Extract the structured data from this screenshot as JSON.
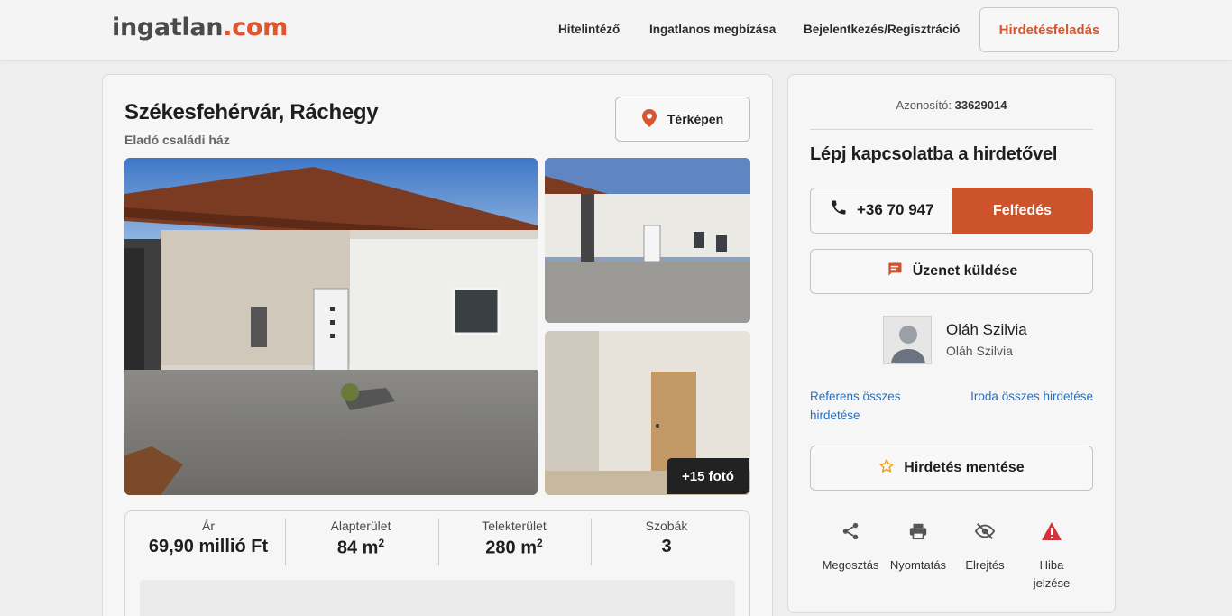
{
  "header": {
    "logo_main": "ingatlan",
    "logo_tld": ".com",
    "nav": [
      "Hitelintéző",
      "Ingatlanos megbízása",
      "Bejelentkezés/Regisztráció"
    ],
    "post_label": "Hirdetésfeladás"
  },
  "listing": {
    "title": "Székesfehérvár, Ráchegy",
    "subtitle": "Eladó családi ház",
    "map_label": "Térképen",
    "more_photos": "+15 fotó"
  },
  "stats": [
    {
      "label": "Ár",
      "value": "69,90 millió Ft",
      "unit_sup": ""
    },
    {
      "label": "Alapterület",
      "value": "84 m",
      "unit_sup": "2"
    },
    {
      "label": "Telekterület",
      "value": "280 m",
      "unit_sup": "2"
    },
    {
      "label": "Szobák",
      "value": "3",
      "unit_sup": ""
    }
  ],
  "side": {
    "id_label": "Azonosító:",
    "id_value": "33629014",
    "contact_title": "Lépj kapcsolatba a hirdetővel",
    "phone": "+36 70 947",
    "reveal_label": "Felfedés",
    "message_label": "Üzenet küldése",
    "agent_name": "Oláh Szilvia",
    "agent_office": "Oláh Szilvia",
    "link_agent": "Referens összes hirdetése",
    "link_office": "Iroda összes hirdetése",
    "save_label": "Hirdetés mentése",
    "actions": [
      "Megosztás",
      "Nyomtatás",
      "Elrejtés",
      "Hiba jelzése"
    ]
  },
  "colors": {
    "brand": "#e0562f",
    "reveal": "#cc532c",
    "link": "#2470c2",
    "warning": "#d1343a",
    "star": "#e8a31d"
  },
  "icons": [
    "location-pin-icon",
    "phone-icon",
    "message-icon",
    "star-outline-icon",
    "share-icon",
    "print-icon",
    "hide-icon",
    "warning-icon"
  ]
}
